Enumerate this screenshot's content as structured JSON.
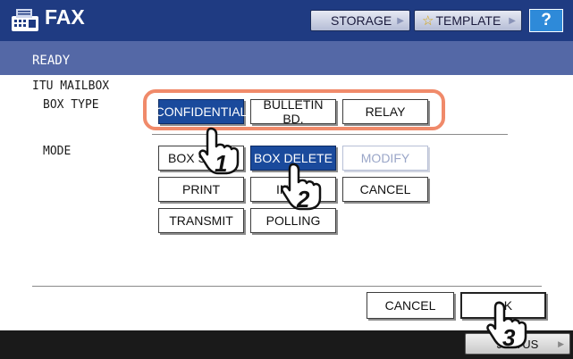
{
  "header": {
    "title": "FAX",
    "storage_label": "STORAGE",
    "template_label": "TEMPLATE",
    "help_label": "?"
  },
  "status": {
    "text": "READY"
  },
  "labels": {
    "mailbox": "ITU MAILBOX",
    "box_type": "BOX TYPE",
    "mode": "MODE"
  },
  "box_type_buttons": [
    "CONFIDENTIAL",
    "BULLETIN BD.",
    "RELAY"
  ],
  "mode_buttons": {
    "box_setup": "BOX S",
    "box_delete": "BOX DELETE",
    "modify": "MODIFY",
    "print": "PRINT",
    "info": "IN",
    "cancel": "CANCEL",
    "transmit": "TRANSMIT",
    "polling": "POLLING"
  },
  "footer": {
    "cancel_label": "CANCEL",
    "ok_label": "OK",
    "job_status_label": "J    TUS"
  },
  "callouts": {
    "step1": "1",
    "step2": "2",
    "step3": "3"
  },
  "colors": {
    "title_bar": "#1f3b82",
    "status_bar": "#5468a6",
    "selected_button": "#1a4a9c",
    "highlight": "#f08a6a",
    "help": "#2e8ad9"
  },
  "icons": {
    "app": "fax-machine-icon",
    "template": "star-icon",
    "pointer": "hand-pointer-icon"
  }
}
